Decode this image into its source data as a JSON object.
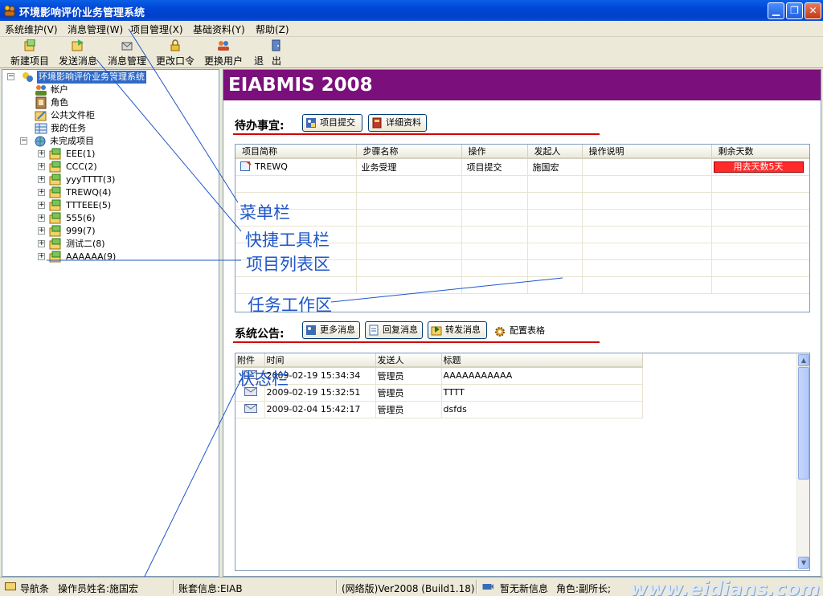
{
  "window": {
    "title": "环境影响评价业务管理系统",
    "icons": [
      "minimize-icon",
      "restore-icon",
      "close-icon"
    ]
  },
  "menu": [
    "系统维护(V)",
    "消息管理(W)",
    "项目管理(X)",
    "基础资料(Y)",
    "帮助(Z)"
  ],
  "toolbar": [
    "新建项目",
    "发送消息",
    "消息管理",
    "更改口令",
    "更换用户",
    "退",
    "出"
  ],
  "tree": {
    "root": "环境影响评价业务管理系统",
    "nodes": [
      "帐户",
      "角色",
      "公共文件柜",
      "我的任务"
    ],
    "group": "未完成项目",
    "projects": [
      "EEE(1)",
      "CCC(2)",
      "yyyTTTT(3)",
      "TREWQ(4)",
      "TTTEEE(5)",
      "555(6)",
      "999(7)",
      "测试二(8)",
      "AAAAAA(9)"
    ]
  },
  "banner": "EIABMIS 2008",
  "todo": {
    "heading": "待办事宜:",
    "buttons": [
      "项目提交",
      "详细资料"
    ],
    "columns": [
      "项目简称",
      "步骤名称",
      "操作",
      "发起人",
      "操作说明",
      "剩余天数"
    ],
    "rows": [
      [
        "TREWQ",
        "业务受理",
        "项目提交",
        "施国宏",
        "",
        "用去天数5天"
      ]
    ]
  },
  "notice": {
    "heading": "系统公告:",
    "buttons": [
      "更多消息",
      "回复消息",
      "转发消息",
      "配置表格"
    ],
    "columns": [
      "附件",
      "时间",
      "发送人",
      "标题"
    ],
    "rows": [
      [
        "",
        "2009-02-19 15:34:34",
        "管理员",
        "AAAAAAAAAAA"
      ],
      [
        "",
        "2009-02-19 15:32:51",
        "管理员",
        "TTTT"
      ],
      [
        "",
        "2009-02-04 15:42:17",
        "管理员",
        "dsfds"
      ]
    ]
  },
  "annotations": [
    "菜单栏",
    "快捷工具栏",
    "项目列表区",
    "任务工作区",
    "状态栏"
  ],
  "status": {
    "nav": "导航条",
    "operator": "操作员姓名:施国宏",
    "account": "账套信息:EIAB",
    "version": "(网络版)Ver2008 (Build1.18)",
    "msg": "暂无新信息",
    "role": "角色:副所长;"
  },
  "watermark": "www.eidians.com",
  "colors": {
    "banner": "#7b0f7b",
    "accent": "#1f57c8",
    "red": "#d40000"
  }
}
